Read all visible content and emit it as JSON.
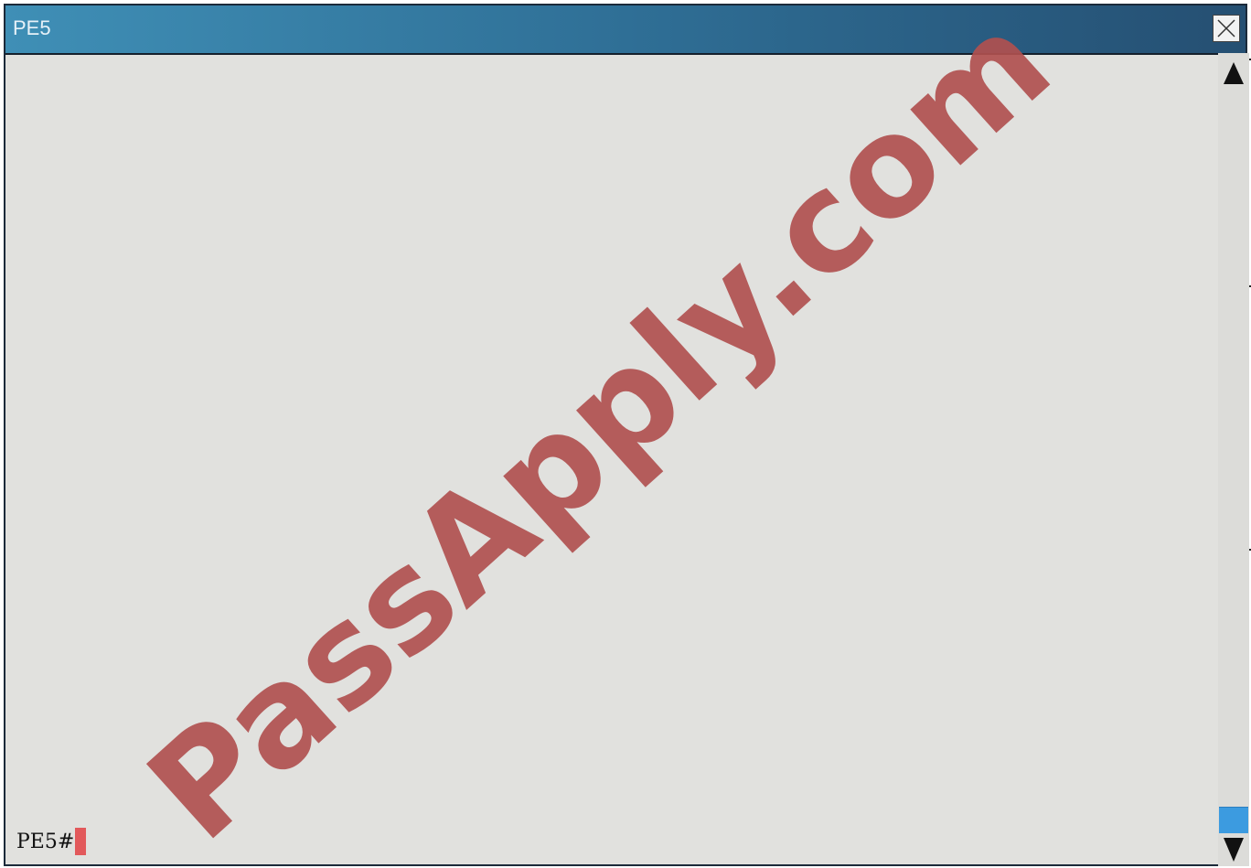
{
  "window": {
    "title": "PE5",
    "colors": {
      "titlebar_start": "#3f8fb6",
      "titlebar_end": "#254f72",
      "terminal_bg": "#e1e1de",
      "cursor": "#e2595b",
      "scroll_thumb": "#3c9be0"
    }
  },
  "terminal": {
    "prompt": "PE5#"
  },
  "watermark": {
    "text": "PassApply.com",
    "color": "#b0504f"
  },
  "icons": {
    "close": "close-icon",
    "scroll_up": "triangle-up-icon",
    "scroll_down": "triangle-down-icon"
  }
}
